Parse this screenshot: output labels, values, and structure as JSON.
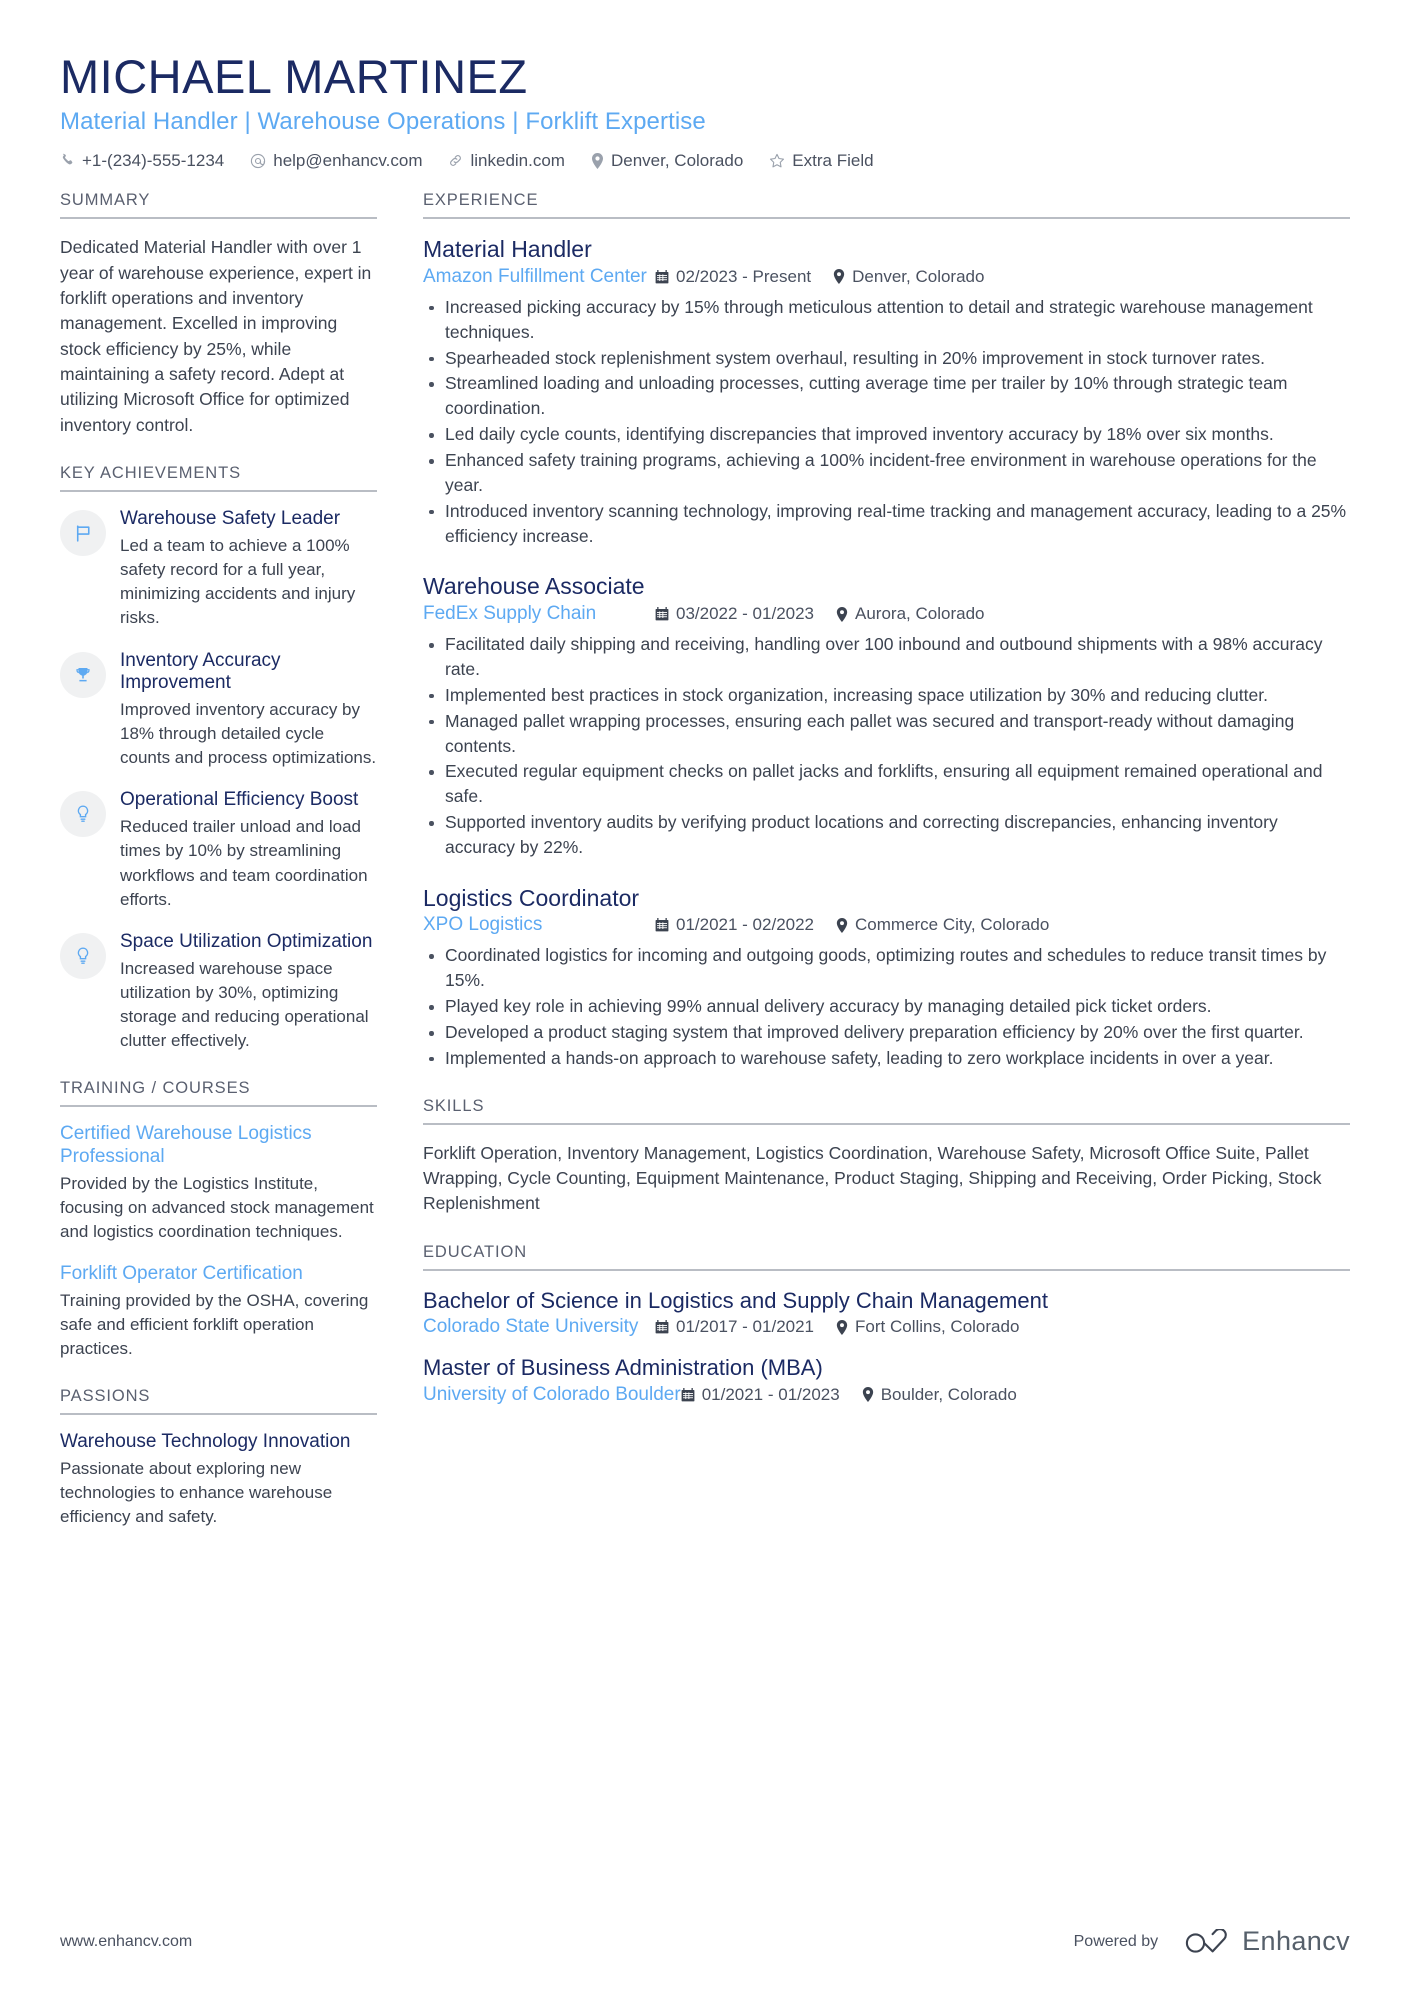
{
  "header": {
    "full_name": "MICHAEL MARTINEZ",
    "job_title": "Material Handler | Warehouse Operations | Forklift Expertise",
    "contacts": [
      {
        "icon": "phone-icon",
        "text": "+1-(234)-555-1234"
      },
      {
        "icon": "email-icon",
        "text": "help@enhancv.com"
      },
      {
        "icon": "link-icon",
        "text": "linkedin.com"
      },
      {
        "icon": "location-pin-icon",
        "text": "Denver, Colorado"
      },
      {
        "icon": "star-icon",
        "text": "Extra Field"
      }
    ]
  },
  "sidebar": {
    "summary": {
      "heading": "SUMMARY",
      "text": "Dedicated Material Handler with over 1 year of warehouse experience, expert in forklift operations and inventory management. Excelled in improving stock efficiency by 25%, while maintaining a safety record. Adept at utilizing Microsoft Office for optimized inventory control."
    },
    "key_achievements": {
      "heading": "KEY ACHIEVEMENTS",
      "items": [
        {
          "icon": "flag-icon",
          "title": "Warehouse Safety Leader",
          "description": "Led a team to achieve a 100% safety record for a full year, minimizing accidents and injury risks."
        },
        {
          "icon": "trophy-icon",
          "title": "Inventory Accuracy Improvement",
          "description": "Improved inventory accuracy by 18% through detailed cycle counts and process optimizations."
        },
        {
          "icon": "lightbulb-icon",
          "title": "Operational Efficiency Boost",
          "description": "Reduced trailer unload and load times by 10% by streamlining workflows and team coordination efforts."
        },
        {
          "icon": "lightbulb-icon",
          "title": "Space Utilization Optimization",
          "description": "Increased warehouse space utilization by 30%, optimizing storage and reducing operational clutter effectively."
        }
      ]
    },
    "training": {
      "heading": "TRAINING / COURSES",
      "items": [
        {
          "title": "Certified Warehouse Logistics Professional",
          "description": "Provided by the Logistics Institute, focusing on advanced stock management and logistics coordination techniques."
        },
        {
          "title": "Forklift Operator Certification",
          "description": "Training provided by the OSHA, covering safe and efficient forklift operation practices."
        }
      ]
    },
    "passions": {
      "heading": "PASSIONS",
      "items": [
        {
          "title": "Warehouse Technology Innovation",
          "description": "Passionate about exploring new technologies to enhance warehouse efficiency and safety."
        }
      ]
    }
  },
  "main": {
    "experience": {
      "heading": "EXPERIENCE",
      "jobs": [
        {
          "role": "Material Handler",
          "company": "Amazon Fulfillment Center",
          "dates": "02/2023 - Present",
          "location": "Denver, Colorado",
          "bullets": [
            "Increased picking accuracy by 15% through meticulous attention to detail and strategic warehouse management techniques.",
            "Spearheaded stock replenishment system overhaul, resulting in 20% improvement in stock turnover rates.",
            "Streamlined loading and unloading processes, cutting average time per trailer by 10% through strategic team coordination.",
            "Led daily cycle counts, identifying discrepancies that improved inventory accuracy by 18% over six months.",
            "Enhanced safety training programs, achieving a 100% incident-free environment in warehouse operations for the year.",
            "Introduced inventory scanning technology, improving real-time tracking and management accuracy, leading to a 25% efficiency increase."
          ]
        },
        {
          "role": "Warehouse Associate",
          "company": "FedEx Supply Chain",
          "dates": "03/2022 - 01/2023",
          "location": "Aurora, Colorado",
          "bullets": [
            "Facilitated daily shipping and receiving, handling over 100 inbound and outbound shipments with a 98% accuracy rate.",
            "Implemented best practices in stock organization, increasing space utilization by 30% and reducing clutter.",
            "Managed pallet wrapping processes, ensuring each pallet was secured and transport-ready without damaging contents.",
            "Executed regular equipment checks on pallet jacks and forklifts, ensuring all equipment remained operational and safe.",
            "Supported inventory audits by verifying product locations and correcting discrepancies, enhancing inventory accuracy by 22%."
          ]
        },
        {
          "role": "Logistics Coordinator",
          "company": "XPO Logistics",
          "dates": "01/2021 - 02/2022",
          "location": "Commerce City, Colorado",
          "bullets": [
            "Coordinated logistics for incoming and outgoing goods, optimizing routes and schedules to reduce transit times by 15%.",
            "Played key role in achieving 99% annual delivery accuracy by managing detailed pick ticket orders.",
            "Developed a product staging system that improved delivery preparation efficiency by 20% over the first quarter.",
            "Implemented a hands-on approach to warehouse safety, leading to zero workplace incidents in over a year."
          ]
        }
      ]
    },
    "skills": {
      "heading": "SKILLS",
      "text": "Forklift Operation, Inventory Management, Logistics Coordination, Warehouse Safety, Microsoft Office Suite, Pallet Wrapping, Cycle Counting, Equipment Maintenance, Product Staging, Shipping and Receiving, Order Picking, Stock Replenishment"
    },
    "education": {
      "heading": "EDUCATION",
      "items": [
        {
          "degree": "Bachelor of Science in Logistics and Supply Chain Management",
          "school": "Colorado State University",
          "dates": "01/2017 - 01/2021",
          "location": "Fort Collins, Colorado"
        },
        {
          "degree": "Master of Business Administration (MBA)",
          "school": "University of Colorado Boulder",
          "dates": "01/2021 - 01/2023",
          "location": "Boulder, Colorado"
        }
      ]
    }
  },
  "footer": {
    "url": "www.enhancv.com",
    "powered_by": "Powered by",
    "brand": "Enhancv"
  },
  "colors": {
    "navy": "#1b2a63",
    "accent_blue": "#5da9f2",
    "body_text": "#3c4350",
    "rule": "#b9bdc4"
  }
}
